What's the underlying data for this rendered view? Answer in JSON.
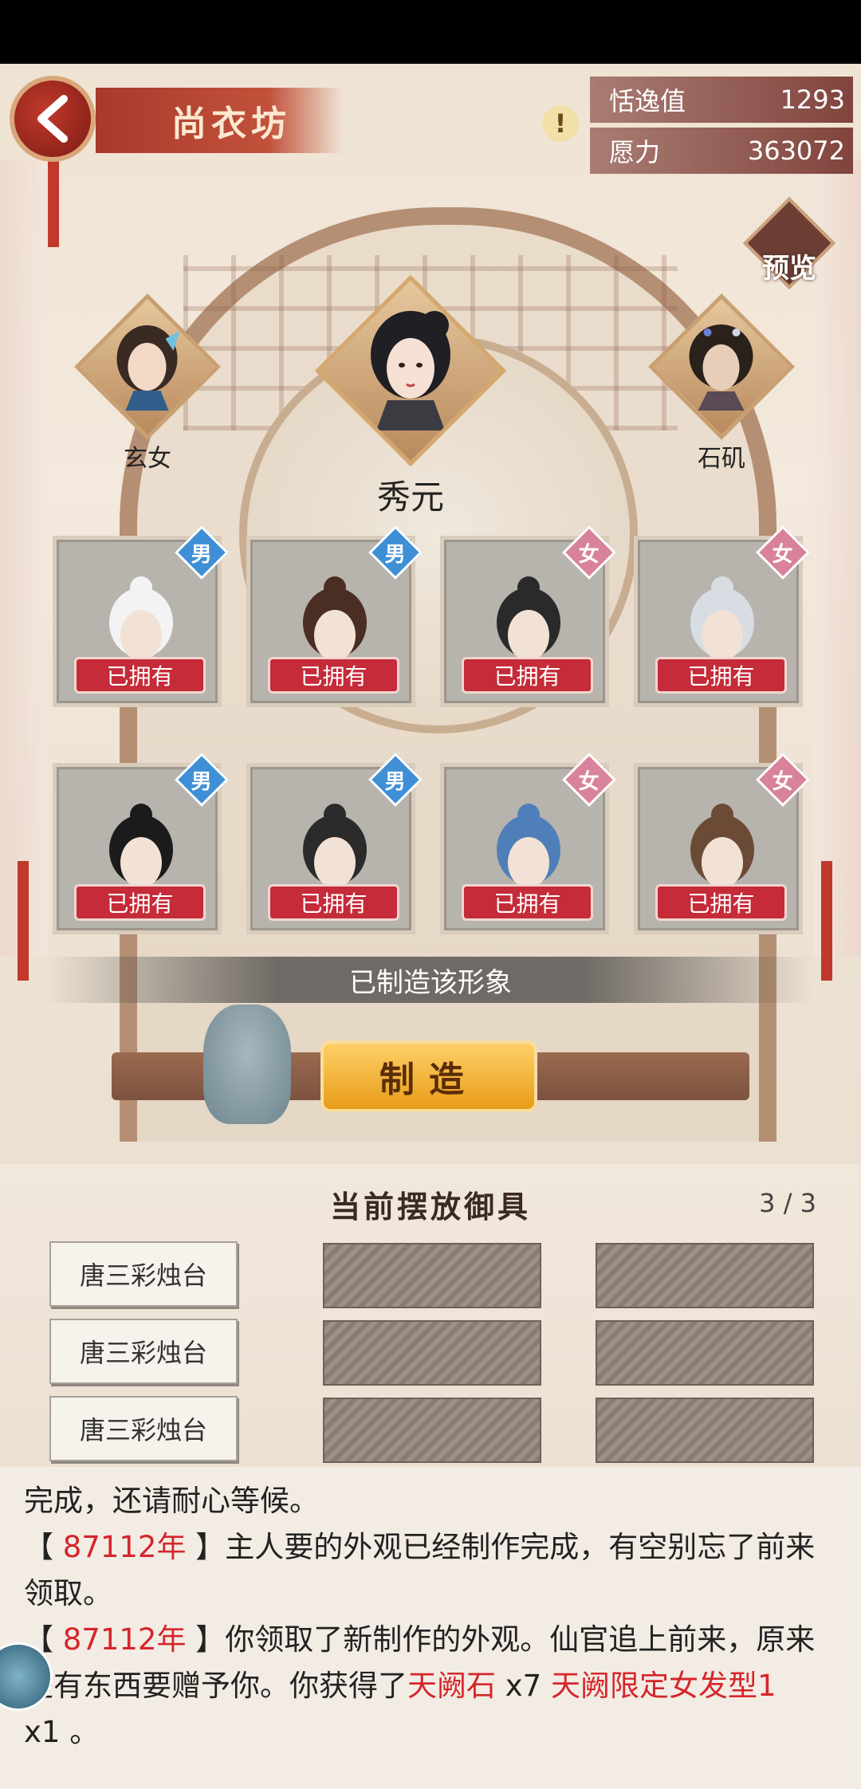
{
  "header": {
    "title": "尚衣坊",
    "stats": [
      {
        "label": "恬逸值",
        "value": "1293"
      },
      {
        "label": "愿力",
        "value": "363072"
      }
    ],
    "preview_label": "预览"
  },
  "characters": {
    "left": {
      "name": "玄女"
    },
    "main": {
      "name": "秀元"
    },
    "right": {
      "name": "石矶"
    }
  },
  "hairstyles": [
    {
      "gender": "男",
      "gender_type": "male",
      "status": "已拥有",
      "hair_color": "#f3f3f3"
    },
    {
      "gender": "男",
      "gender_type": "male",
      "status": "已拥有",
      "hair_color": "#4a2e24"
    },
    {
      "gender": "女",
      "gender_type": "female",
      "status": "已拥有",
      "hair_color": "#2a2a2a"
    },
    {
      "gender": "女",
      "gender_type": "female",
      "status": "已拥有",
      "hair_color": "#d7dde2"
    },
    {
      "gender": "男",
      "gender_type": "male",
      "status": "已拥有",
      "hair_color": "#1b1b1b"
    },
    {
      "gender": "男",
      "gender_type": "male",
      "status": "已拥有",
      "hair_color": "#2b2b2b"
    },
    {
      "gender": "女",
      "gender_type": "female",
      "status": "已拥有",
      "hair_color": "#4f7fb8"
    },
    {
      "gender": "女",
      "gender_type": "female",
      "status": "已拥有",
      "hair_color": "#6b4a36"
    }
  ],
  "status_text": "已制造该形象",
  "make_button": "制造",
  "furniture": {
    "title": "当前摆放御具",
    "count": "3 / 3",
    "items": [
      "唐三彩烛台",
      "唐三彩烛台",
      "唐三彩烛台"
    ]
  },
  "log": {
    "line1_tail": "完成，还请耐心等候。",
    "entry2_year": "87112年",
    "entry2_text": "主人要的外观已经制作完成，有空别忘了前来",
    "entry2_tail": "领取。",
    "entry3_year": "87112年",
    "entry3_text": "你领取了新制作的外观。仙官追上前来，原来",
    "entry3_line2_start": "是有东西要赠予你。你获得了",
    "reward1": "天阙石",
    "reward1_qty": " x7  ",
    "reward2": "天阙限定女发型1",
    "entry3_line3": "x1    。"
  },
  "colors": {
    "male_badge": "#3f8fd6",
    "female_badge": "#d8839b",
    "owned_badge": "#c52b38",
    "highlight_red": "#d5262b",
    "make_button": "#f2b136"
  }
}
